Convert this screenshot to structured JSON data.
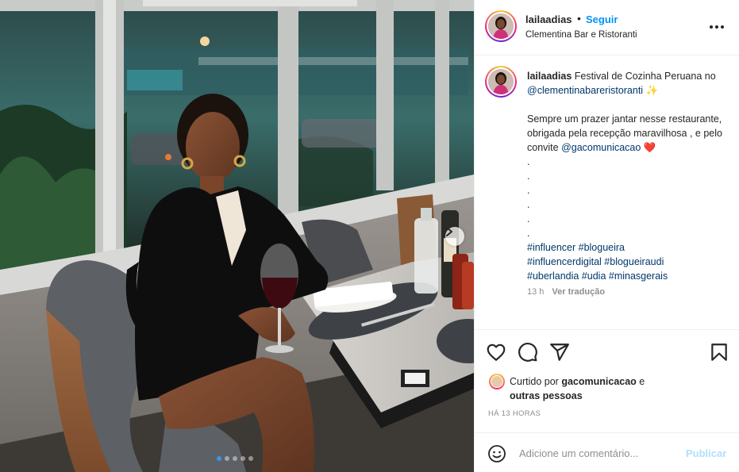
{
  "post": {
    "username": "lailaadias",
    "bullet": "•",
    "follow_label": "Seguir",
    "location": "Clementina Bar e Ristoranti",
    "more_icon": "more-horizontal-icon"
  },
  "caption": {
    "username": "lailaadias",
    "text_intro": "Festival de Cozinha Peruana no",
    "mention_restaurant": "@clementinabareristoranti",
    "sparkle_emoji": "✨",
    "body": "Sempre um prazer jantar nesse restaurante, obrigada pela recepção maravilhosa , e pelo convite",
    "mention_agency": "@gacomunicacao",
    "heart_emoji": "❤️",
    "dots": [
      ".",
      ".",
      ".",
      ".",
      ".",
      "."
    ],
    "hashtags_line1": "#influencer #blogueira",
    "hashtags_line2": "#influencerdigital #blogueiraudi",
    "hashtags_line3": "#uberlandia #udia #minasgerais",
    "time": "13 h",
    "translate_label": "Ver tradução"
  },
  "actions": {
    "like_icon": "heart-icon",
    "comment_icon": "comment-icon",
    "share_icon": "send-icon",
    "save_icon": "bookmark-icon"
  },
  "likes": {
    "prefix": "Curtido por",
    "user": "gacomunicacao",
    "conjunction": "e",
    "others": "outras pessoas"
  },
  "timestamp": "HÁ 13 HORAS",
  "comment": {
    "placeholder": "Adicione um comentário...",
    "publish_label": "Publicar"
  },
  "carousel": {
    "total_slides": 5,
    "active_slide": 1
  },
  "colors": {
    "accent": "#0095f6",
    "link": "#00376b",
    "publish_disabled": "#b2dffc",
    "heart": "#ed4956",
    "carousel_active": "#3897f0"
  }
}
